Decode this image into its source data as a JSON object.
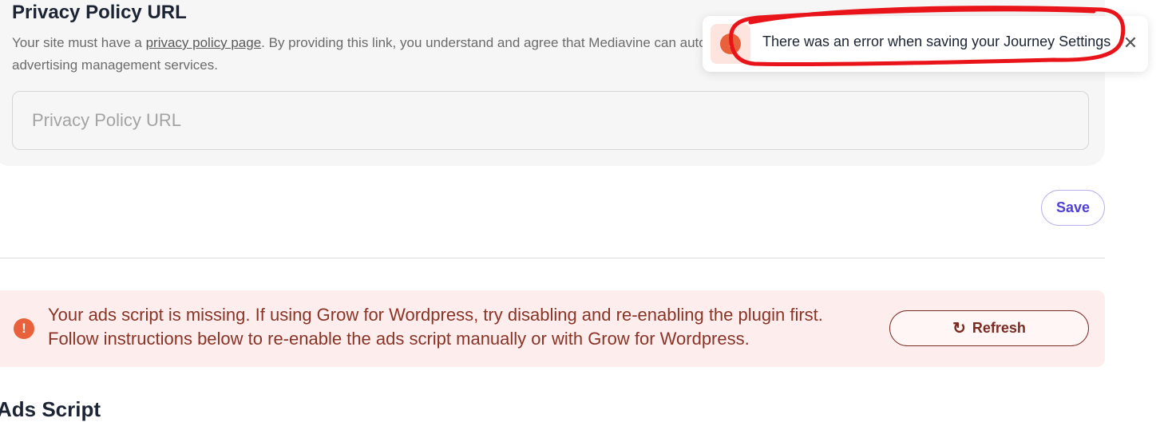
{
  "privacy": {
    "title": "Privacy Policy URL",
    "description": {
      "before_link": "Your site must have a ",
      "link": "privacy policy page",
      "after_link": ". By providing this link, you understand and agree that Mediavine can auto",
      "line2": "advertising management services."
    },
    "input_placeholder": "Privacy Policy URL",
    "input_value": ""
  },
  "actions": {
    "save_label": "Save"
  },
  "alert": {
    "icon": "exclamation-circle-icon",
    "line1": "Your ads script is missing. If using Grow for Wordpress, try disabling and re-enabling the plugin first.",
    "line2": "Follow instructions below to re-enable the ads script manually or with Grow for Wordpress.",
    "button_label": "Refresh",
    "button_icon": "refresh-icon"
  },
  "next_section": {
    "title": "Ads Script"
  },
  "toast": {
    "message": "There was an error when saving your Journey Settings",
    "icon": "exclamation-circle-icon",
    "close_icon": "close-icon"
  },
  "colors": {
    "accent": "#4f3fd6",
    "error": "#e8613a",
    "alert_bg": "#fdeeed",
    "alert_text": "#8a3326",
    "annotation": "#e8141a"
  }
}
